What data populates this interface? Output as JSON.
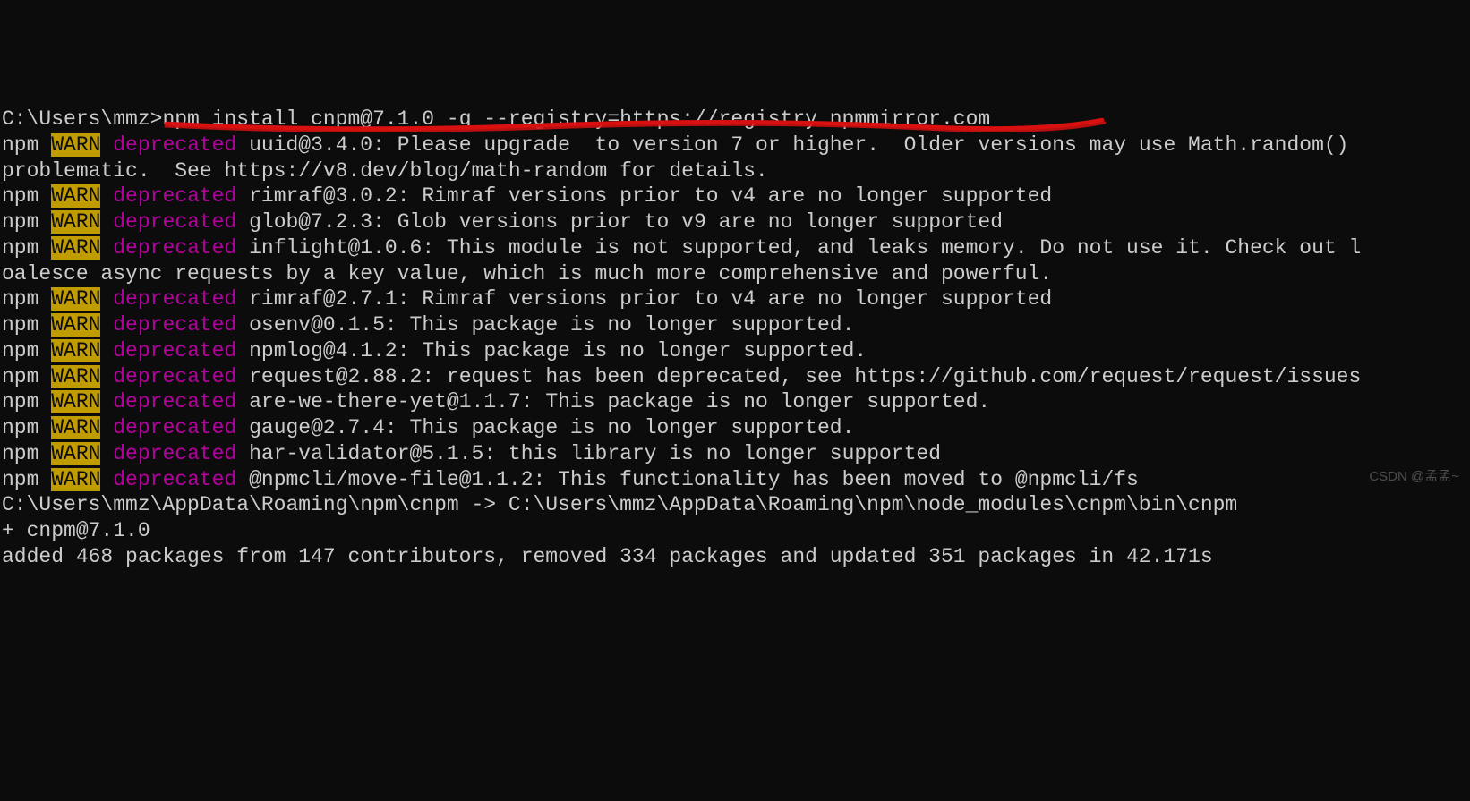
{
  "prompt": "C:\\Users\\mmz>",
  "command": "npm install cnpm@7.1.0 -g --registry=https://registry.npmmirror.com",
  "lines": [
    {
      "type": "warn",
      "msg": "uuid@3.4.0: Please upgrade  to version 7 or higher.  Older versions may use Math.random()"
    },
    {
      "type": "plain",
      "msg": "problematic.  See https://v8.dev/blog/math-random for details."
    },
    {
      "type": "warn",
      "msg": "rimraf@3.0.2: Rimraf versions prior to v4 are no longer supported"
    },
    {
      "type": "warn",
      "msg": "glob@7.2.3: Glob versions prior to v9 are no longer supported"
    },
    {
      "type": "warn",
      "msg": "inflight@1.0.6: This module is not supported, and leaks memory. Do not use it. Check out l"
    },
    {
      "type": "plain",
      "msg": "oalesce async requests by a key value, which is much more comprehensive and powerful."
    },
    {
      "type": "warn",
      "msg": "rimraf@2.7.1: Rimraf versions prior to v4 are no longer supported"
    },
    {
      "type": "warn",
      "msg": "osenv@0.1.5: This package is no longer supported."
    },
    {
      "type": "warn",
      "msg": "npmlog@4.1.2: This package is no longer supported."
    },
    {
      "type": "warn",
      "msg": "request@2.88.2: request has been deprecated, see https://github.com/request/request/issues"
    },
    {
      "type": "warn",
      "msg": "are-we-there-yet@1.1.7: This package is no longer supported."
    },
    {
      "type": "warn",
      "msg": "gauge@2.7.4: This package is no longer supported."
    },
    {
      "type": "warn",
      "msg": "har-validator@5.1.5: this library is no longer supported"
    },
    {
      "type": "warn",
      "msg": "@npmcli/move-file@1.1.2: This functionality has been moved to @npmcli/fs"
    }
  ],
  "label_npm": "npm",
  "label_warn": "WARN",
  "label_deprecated": "deprecated",
  "footer": {
    "link": "C:\\Users\\mmz\\AppData\\Roaming\\npm\\cnpm -> C:\\Users\\mmz\\AppData\\Roaming\\npm\\node_modules\\cnpm\\bin\\cnpm",
    "pkg": "+ cnpm@7.1.0",
    "summary": "added 468 packages from 147 contributors, removed 334 packages and updated 351 packages in 42.171s"
  },
  "watermark": "CSDN @孟孟~"
}
